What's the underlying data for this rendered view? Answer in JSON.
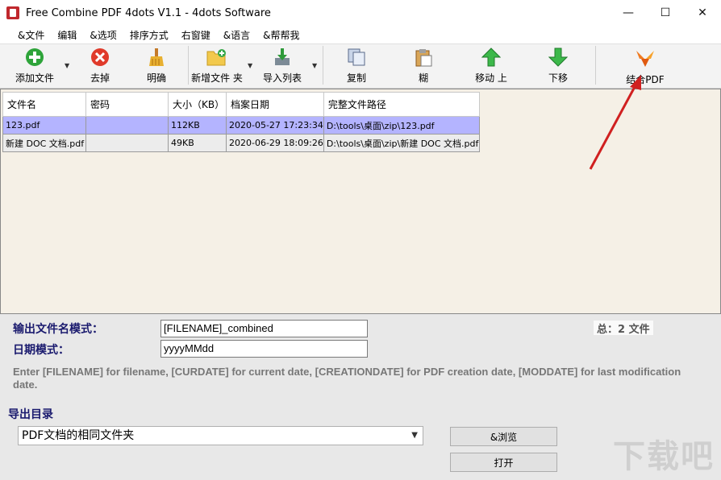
{
  "window": {
    "title": "Free Combine PDF 4dots V1.1 - 4dots Software",
    "minimize": "—",
    "maximize": "☐",
    "close": "✕"
  },
  "menu": [
    "&文件",
    "编辑",
    "&选项",
    "排序方式",
    "右窗键",
    "&语言",
    "&帮帮我"
  ],
  "toolbar": {
    "add_file": "添加文件",
    "remove": "去掉",
    "clear": "明确",
    "new_folder": "新增文件 夹",
    "import_list": "导入列表",
    "copy": "复制",
    "paste": "糊",
    "move_up": "移动 上",
    "move_down": "下移",
    "combine": "结合PDF"
  },
  "table": {
    "columns": [
      "文件名",
      "密码",
      "大小（KB）",
      "档案日期",
      "完整文件路径"
    ],
    "rows": [
      {
        "name": "123.pdf",
        "password": "",
        "size": "112KB",
        "date": "2020-05-27 17:23:34",
        "path": "D:\\tools\\桌面\\zip\\123.pdf"
      },
      {
        "name": "新建 DOC 文档.pdf",
        "password": "",
        "size": "49KB",
        "date": "2020-06-29 18:09:26",
        "path": "D:\\tools\\桌面\\zip\\新建 DOC 文档.pdf"
      }
    ]
  },
  "output": {
    "filename_label": "输出文件名模式：",
    "filename_value": "[FILENAME]_combined",
    "date_label": "日期模式：",
    "date_value": "yyyyMMdd",
    "total": "总：2 文件",
    "hint": "Enter [FILENAME] for filename, [CURDATE] for current date, [CREATIONDATE] for PDF creation date, [MODDATE] for last modification date."
  },
  "export": {
    "title": "导出目录",
    "selected": "PDF文档的相同文件夹",
    "browse": "&浏览",
    "open": "打开"
  },
  "watermark": "下载吧",
  "colors": {
    "selected_row": "#b4b4ff",
    "list_bg": "#f5f0e6",
    "label_blue": "#1a1a6e",
    "annotation_arrow": "#d02020"
  }
}
